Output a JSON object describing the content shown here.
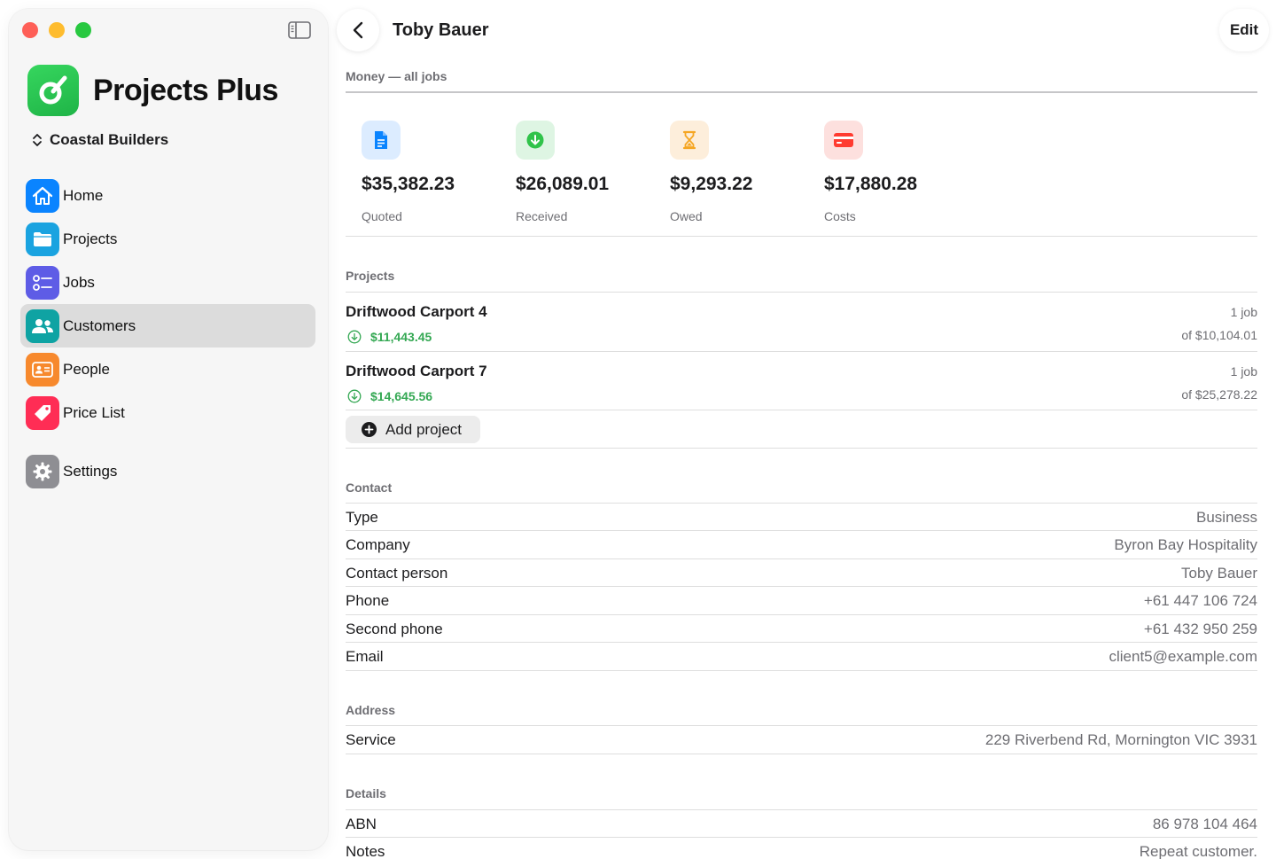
{
  "app": {
    "name": "Projects Plus",
    "organization": "Coastal Builders"
  },
  "sidebar": {
    "items": [
      {
        "label": "Home",
        "icon": "house-icon",
        "color": "#0a84ff"
      },
      {
        "label": "Projects",
        "icon": "folder-icon",
        "color": "#1aa3e0"
      },
      {
        "label": "Jobs",
        "icon": "checklist-icon",
        "color": "#5e5ce6"
      },
      {
        "label": "Customers",
        "icon": "people-icon",
        "color": "#0fa3a3",
        "active": true
      },
      {
        "label": "People",
        "icon": "id-card-icon",
        "color": "#f7892d"
      },
      {
        "label": "Price List",
        "icon": "tag-icon",
        "color": "#ff2d55"
      },
      {
        "label": "Settings",
        "icon": "gear-icon",
        "color": "#8e8e93"
      }
    ]
  },
  "header": {
    "title": "Toby Bauer",
    "edit_label": "Edit"
  },
  "money": {
    "header": "Money — all jobs",
    "stats": [
      {
        "value": "$35,382.23",
        "label": "Quoted",
        "icon": "document-icon",
        "color": "#0a84ff",
        "bg": "#dcecff"
      },
      {
        "value": "$26,089.01",
        "label": "Received",
        "icon": "arrow-down-circle-icon",
        "color": "#30c34a",
        "bg": "#def5e3"
      },
      {
        "value": "$9,293.22",
        "label": "Owed",
        "icon": "hourglass-icon",
        "color": "#f5a623",
        "bg": "#fdeedb"
      },
      {
        "value": "$17,880.28",
        "label": "Costs",
        "icon": "credit-card-icon",
        "color": "#ff3b30",
        "bg": "#fde0de"
      }
    ]
  },
  "projects": {
    "header": "Projects",
    "items": [
      {
        "name": "Driftwood Carport 4",
        "paid": "$11,443.45",
        "jobs": "1 job",
        "of": "of $10,104.01"
      },
      {
        "name": "Driftwood Carport 7",
        "paid": "$14,645.56",
        "jobs": "1 job",
        "of": "of $25,278.22"
      }
    ],
    "add_label": "Add project"
  },
  "contact": {
    "header": "Contact",
    "rows": [
      {
        "label": "Type",
        "value": "Business"
      },
      {
        "label": "Company",
        "value": "Byron Bay Hospitality"
      },
      {
        "label": "Contact person",
        "value": "Toby Bauer"
      },
      {
        "label": "Phone",
        "value": "+61 447 106 724"
      },
      {
        "label": "Second phone",
        "value": "+61 432 950 259"
      },
      {
        "label": "Email",
        "value": "client5@example.com"
      }
    ]
  },
  "address": {
    "header": "Address",
    "rows": [
      {
        "label": "Service",
        "value": "229 Riverbend Rd, Mornington VIC 3931"
      }
    ]
  },
  "details": {
    "header": "Details",
    "rows": [
      {
        "label": "ABN",
        "value": "86 978 104 464"
      },
      {
        "label": "Notes",
        "value": "Repeat customer."
      }
    ]
  }
}
